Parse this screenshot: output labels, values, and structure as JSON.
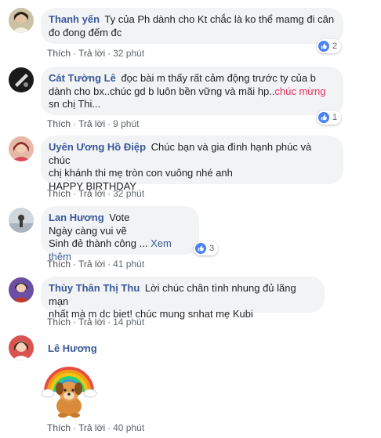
{
  "actions": {
    "like": "Thích",
    "reply": "Trả lời",
    "separator": "·"
  },
  "colors": {
    "name": "#385898",
    "bubble": "#f2f3f5",
    "like": "#4a82f1",
    "highlight": "#e4335f"
  },
  "comments": [
    {
      "name": "Thanh yến",
      "lines": [
        "Ty của Ph dành cho Kt chắc là ko thể mamg đi cân",
        "đo đong đếm đc"
      ],
      "time": "32 phút",
      "reactions": "2"
    },
    {
      "name": "Cát Tường Lê",
      "lines": [
        "đọc bài m thấy rất cảm động trước ty của b",
        "dành cho bx..chúc gd b luôn bền vững và mãi hp.."
      ],
      "highlight": "chúc mừng",
      "line3": "sn chị Thi...",
      "time": "9 phút",
      "reactions": "1"
    },
    {
      "name": "Uyên Ương Hồ Điệp",
      "lines": [
        "Chúc bạn và gia đình hạnh phúc và chúc",
        "chị khánh thi mẹ tròn con vuông nhé anh",
        "HAPPY BIRTHDAY"
      ],
      "time": "32 phút"
    },
    {
      "name": "Lan Hương",
      "lines": [
        "Vote",
        "Ngày càng vui vẽ",
        "Sinh đẻ thành công ..."
      ],
      "see_more": "Xem thêm",
      "time": "41 phút",
      "reactions": "3"
    },
    {
      "name": "Thùy Thân Thị Thu",
      "lines": [
        "Lời chúc chân tình nhung đủ lãng mạn",
        "nhất mà m dc biet! chúc mung snhat mẹ Kubi"
      ],
      "time": "14 phút"
    },
    {
      "name": "Lê Hương",
      "sticker": "rainbow-dog-sticker",
      "time": "40 phút"
    }
  ]
}
